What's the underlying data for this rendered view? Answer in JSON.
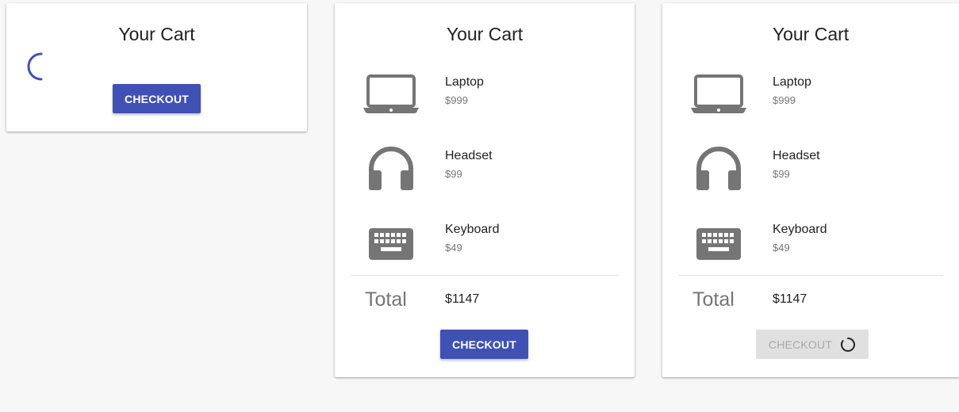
{
  "colors": {
    "primary": "#3f51b5",
    "icon": "#757575",
    "disabled_bg": "#e0e0e0",
    "disabled_text": "#a8a8a8"
  },
  "cards": [
    {
      "state": "loading",
      "title": "Your Cart",
      "loading_icon": "spinner-icon",
      "checkout_label": "CHECKOUT"
    },
    {
      "state": "loaded",
      "title": "Your Cart",
      "items": [
        {
          "name": "Laptop",
          "price": "$999",
          "icon": "laptop-icon"
        },
        {
          "name": "Headset",
          "price": "$99",
          "icon": "headset-icon"
        },
        {
          "name": "Keyboard",
          "price": "$49",
          "icon": "keyboard-icon"
        }
      ],
      "total_label": "Total",
      "total_value": "$1147",
      "checkout_label": "CHECKOUT"
    },
    {
      "state": "checking-out",
      "title": "Your Cart",
      "items": [
        {
          "name": "Laptop",
          "price": "$999",
          "icon": "laptop-icon"
        },
        {
          "name": "Headset",
          "price": "$99",
          "icon": "headset-icon"
        },
        {
          "name": "Keyboard",
          "price": "$49",
          "icon": "keyboard-icon"
        }
      ],
      "total_label": "Total",
      "total_value": "$1147",
      "checkout_label": "CHECKOUT",
      "checkout_icon": "spinner-icon"
    }
  ]
}
